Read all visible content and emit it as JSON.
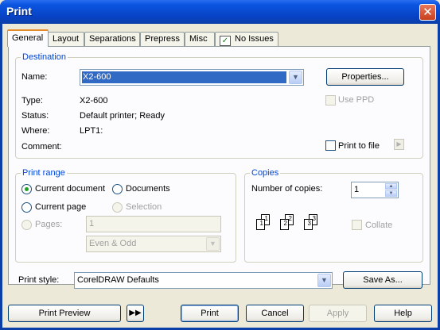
{
  "window": {
    "title": "Print",
    "close_glyph": "✕"
  },
  "tabs": [
    {
      "label": "General"
    },
    {
      "label": "Layout"
    },
    {
      "label": "Separations"
    },
    {
      "label": "Prepress"
    },
    {
      "label": "Misc"
    },
    {
      "label": "No Issues",
      "icon": "shield-check-icon"
    }
  ],
  "destination": {
    "group_label": "Destination",
    "name_label": "Name:",
    "name_value": "X2-600",
    "properties_button": "Properties...",
    "use_ppd_label": "Use PPD",
    "type_label": "Type:",
    "type_value": "X2-600",
    "status_label": "Status:",
    "status_value": "Default printer; Ready",
    "where_label": "Where:",
    "where_value": "LPT1:",
    "comment_label": "Comment:",
    "print_to_file_label": "Print to file"
  },
  "print_range": {
    "group_label": "Print range",
    "current_document": "Current document",
    "documents": "Documents",
    "current_page": "Current page",
    "selection": "Selection",
    "pages_label": "Pages:",
    "pages_value": "1",
    "odd_even_value": "Even & Odd"
  },
  "copies": {
    "group_label": "Copies",
    "number_label": "Number of copies:",
    "number_value": "1",
    "collate_label": "Collate",
    "page_numbers": [
      "1",
      "2",
      "3"
    ]
  },
  "print_style": {
    "label": "Print style:",
    "value": "CorelDRAW Defaults",
    "save_as_button": "Save As..."
  },
  "footer": {
    "print_preview": "Print Preview",
    "print": "Print",
    "cancel": "Cancel",
    "apply": "Apply",
    "help": "Help"
  },
  "colors": {
    "titlebar": "#0a55e0",
    "dialog_bg": "#ece9d8",
    "group_label": "#0046d5",
    "selection_bg": "#316ac5"
  }
}
